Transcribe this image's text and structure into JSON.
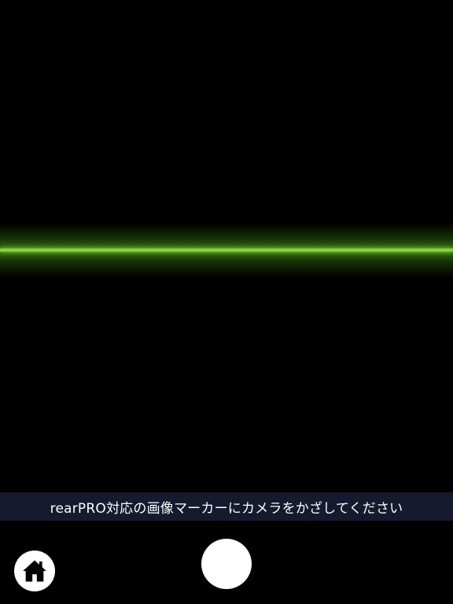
{
  "scanner": {
    "scan_line_color": "#7ed43a",
    "background_color": "#000000"
  },
  "banner": {
    "instruction": "rearPRO対応の画像マーカーにカメラをかざしてください",
    "background_color": "#161a2e"
  },
  "controls": {
    "home_icon": "home-icon",
    "shutter": "shutter-button"
  }
}
